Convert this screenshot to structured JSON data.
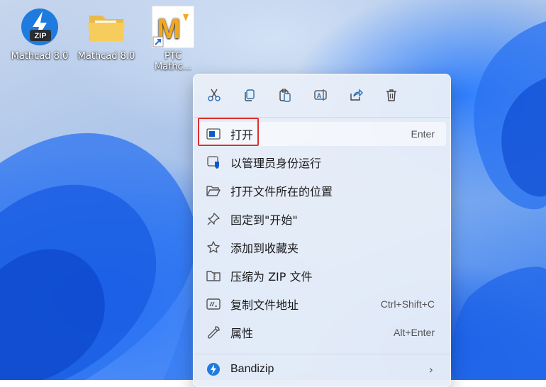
{
  "desktop": {
    "icons": [
      {
        "name": "zip-archive",
        "label": "Mathcad 8.0"
      },
      {
        "name": "folder",
        "label": "Mathcad 8.0"
      },
      {
        "name": "ptc-shortcut",
        "label_line1": "PTC",
        "label_line2": "Mathc..."
      }
    ]
  },
  "context_menu": {
    "toolbar": [
      "cut-icon",
      "copy-icon",
      "paste-icon",
      "rename-icon",
      "share-icon",
      "delete-icon"
    ],
    "items": [
      {
        "label": "打开",
        "shortcut": "Enter"
      },
      {
        "label": "以管理员身份运行"
      },
      {
        "label": "打开文件所在的位置"
      },
      {
        "label": "固定到\"开始\""
      },
      {
        "label": "添加到收藏夹"
      },
      {
        "label": "压缩为 ZIP 文件"
      },
      {
        "label": "复制文件地址",
        "shortcut": "Ctrl+Shift+C"
      },
      {
        "label": "属性",
        "shortcut": "Alt+Enter"
      },
      {
        "label": "Bandizip"
      }
    ]
  },
  "colors": {
    "accent": "#0067c0",
    "highlight_border": "#e03030",
    "menu_bg": "#e8eef8"
  }
}
